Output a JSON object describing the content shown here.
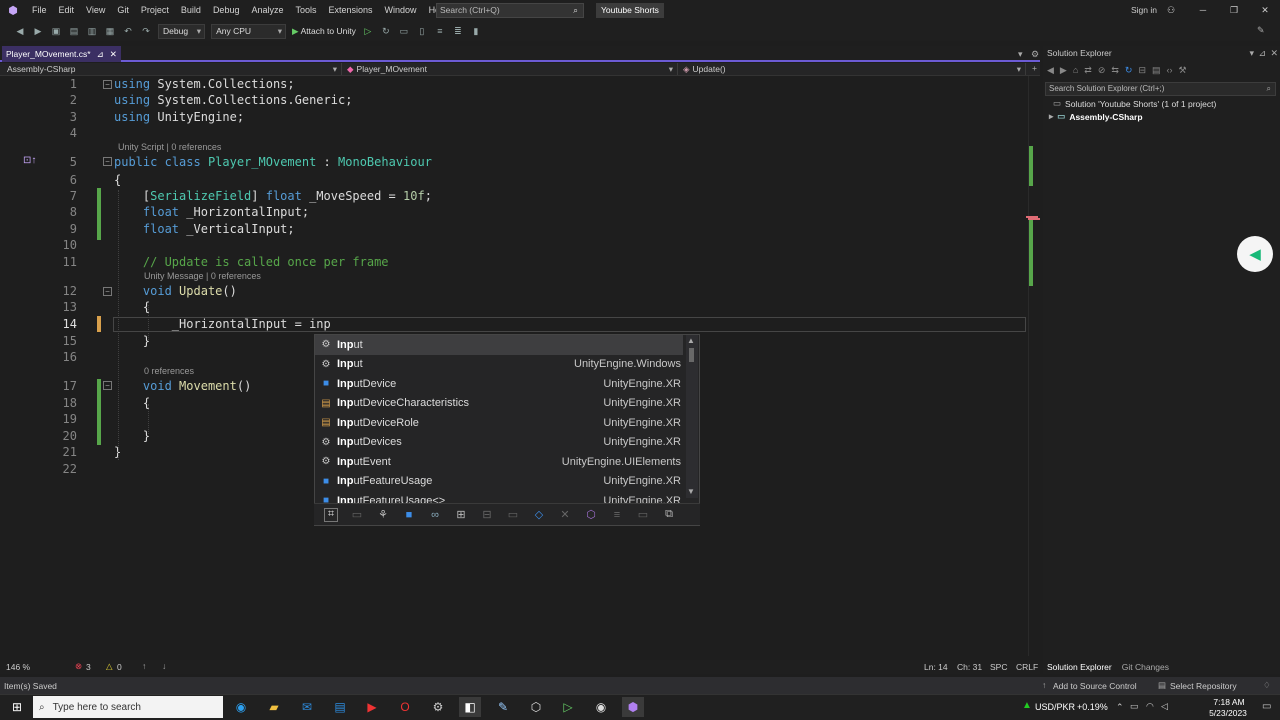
{
  "menu": [
    "File",
    "Edit",
    "View",
    "Git",
    "Project",
    "Build",
    "Debug",
    "Analyze",
    "Tools",
    "Extensions",
    "Window",
    "Help"
  ],
  "search": {
    "placeholder": "Search (Ctrl+Q)"
  },
  "solution_name": "Youtube Shorts",
  "sign_in": "Sign in",
  "toolbar": {
    "config": "Debug",
    "platform": "Any CPU",
    "attach": "Attach to Unity"
  },
  "document_tab": "Player_MOvement.cs*",
  "nav": {
    "project": "Assembly-CSharp",
    "type": "Player_MOvement",
    "member": "Update()"
  },
  "code_lines": [
    {
      "n": "1",
      "text": "using System.Collections;"
    },
    {
      "n": "2",
      "text": "using System.Collections.Generic;"
    },
    {
      "n": "3",
      "text": "using UnityEngine;"
    },
    {
      "n": "4",
      "text": ""
    },
    {
      "n": "5",
      "text": "public class Player_MOvement : MonoBehaviour"
    },
    {
      "n": "6",
      "text": "{"
    },
    {
      "n": "7",
      "text": "    [SerializeField] float _MoveSpeed = 10f;"
    },
    {
      "n": "8",
      "text": "    float _HorizontalInput;"
    },
    {
      "n": "9",
      "text": "    float _VerticalInput;"
    },
    {
      "n": "10",
      "text": ""
    },
    {
      "n": "11",
      "text": "    // Update is called once per frame"
    },
    {
      "n": "12",
      "text": "    void Update()"
    },
    {
      "n": "13",
      "text": "    {"
    },
    {
      "n": "14",
      "text": "        _HorizontalInput = inp"
    },
    {
      "n": "15",
      "text": "    }"
    },
    {
      "n": "16",
      "text": ""
    },
    {
      "n": "17",
      "text": "    void Movement()"
    },
    {
      "n": "18",
      "text": "    {"
    },
    {
      "n": "19",
      "text": ""
    },
    {
      "n": "20",
      "text": "    }"
    },
    {
      "n": "21",
      "text": "}"
    },
    {
      "n": "22",
      "text": ""
    }
  ],
  "codelens": {
    "class": "Unity Script | 0 references",
    "update": "Unity Message | 0 references",
    "movement": "0 references"
  },
  "completion": {
    "items": [
      {
        "label": "Input",
        "ns": "",
        "icon": "class-icon",
        "selected": true
      },
      {
        "label": "Input",
        "ns": "UnityEngine.Windows",
        "icon": "class-icon",
        "selected": false
      },
      {
        "label": "InputDevice",
        "ns": "UnityEngine.XR",
        "icon": "struct-icon",
        "selected": false
      },
      {
        "label": "InputDeviceCharacteristics",
        "ns": "UnityEngine.XR",
        "icon": "enum-icon",
        "selected": false
      },
      {
        "label": "InputDeviceRole",
        "ns": "UnityEngine.XR",
        "icon": "enum-icon",
        "selected": false
      },
      {
        "label": "InputDevices",
        "ns": "UnityEngine.XR",
        "icon": "class-icon",
        "selected": false
      },
      {
        "label": "InputEvent",
        "ns": "UnityEngine.UIElements",
        "icon": "class-icon",
        "selected": false
      },
      {
        "label": "InputFeatureUsage",
        "ns": "UnityEngine.XR",
        "icon": "struct-icon",
        "selected": false
      },
      {
        "label": "InputFeatureUsage<>",
        "ns": "UnityEngine.XR",
        "icon": "struct-icon",
        "selected": false
      }
    ]
  },
  "editor_status": {
    "zoom": "146 %",
    "errors": "3",
    "warnings": "0",
    "position": "Ln: 14",
    "column": "Ch: 31",
    "spc": "SPC",
    "eol": "CRLF"
  },
  "solution_explorer": {
    "title": "Solution Explorer",
    "search_placeholder": "Search Solution Explorer (Ctrl+;)",
    "solution": "Solution 'Youtube Shorts' (1 of 1 project)",
    "project": "Assembly-CSharp",
    "tabs": [
      "Solution Explorer",
      "Git Changes"
    ]
  },
  "app_status": {
    "left": "Item(s) Saved",
    "source_control": "Add to Source Control",
    "repository": "Select Repository"
  },
  "taskbar": {
    "search_placeholder": "Type here to search",
    "currency": "USD/PKR",
    "change": "+0.19%",
    "time": "7:18 AM",
    "date": "5/23/2023"
  },
  "colors": {
    "accent": "#6c5bd4",
    "keyword": "#569cd6",
    "type": "#4ec9b0",
    "comment": "#57a64a",
    "method": "#dcdcaa",
    "number": "#b5cea8"
  }
}
